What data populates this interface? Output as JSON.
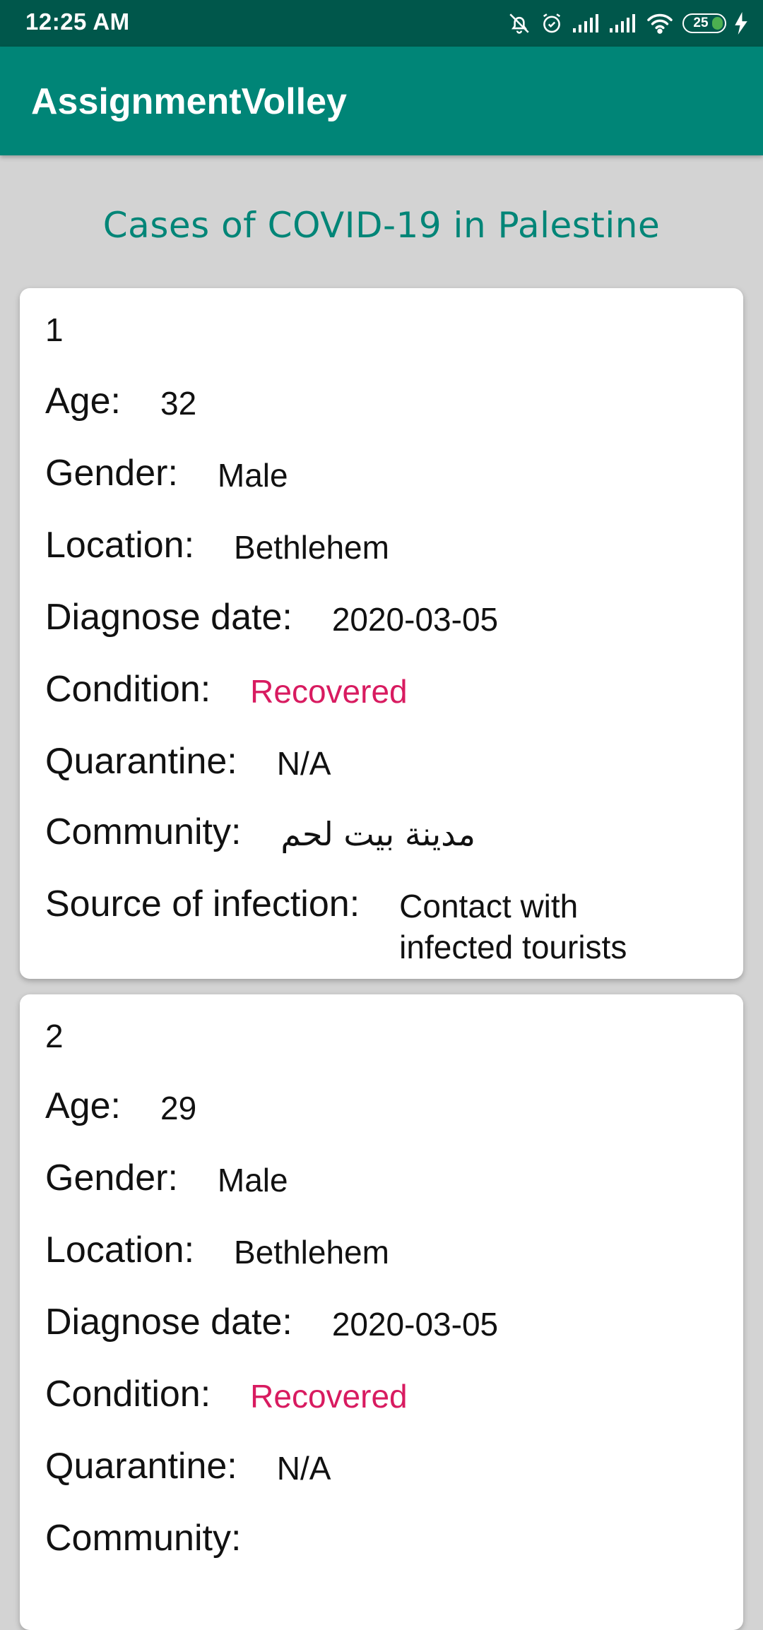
{
  "status_bar": {
    "time": "12:25 AM",
    "battery": "25",
    "icons": [
      "bell-off-icon",
      "alarm-icon",
      "signal-icon",
      "signal-icon",
      "wifi-icon",
      "battery-icon",
      "charging-icon"
    ]
  },
  "app_bar": {
    "title": "AssignmentVolley"
  },
  "heading": "Cases of COVID-19 in Palestine",
  "labels": {
    "age": "Age:",
    "gender": "Gender:",
    "location": "Location:",
    "diagnose_date": "Diagnose date:",
    "condition": "Condition:",
    "quarantine": "Quarantine:",
    "community": "Community:",
    "source": "Source of infection:"
  },
  "cases": [
    {
      "number": "1",
      "age": "32",
      "gender": "Male",
      "location": "Bethlehem",
      "diagnose_date": "2020-03-05",
      "condition": "Recovered",
      "quarantine": "N/A",
      "community": "مدينة بيت لحم",
      "source": "Contact with infected tourists"
    },
    {
      "number": "2",
      "age": "29",
      "gender": "Male",
      "location": "Bethlehem",
      "diagnose_date": "2020-03-05",
      "condition": "Recovered",
      "quarantine": "N/A"
    }
  ],
  "colors": {
    "status_bar": "#00574b",
    "app_bar": "#008577",
    "condition_text": "#d81b60",
    "background": "#d3d3d3"
  }
}
